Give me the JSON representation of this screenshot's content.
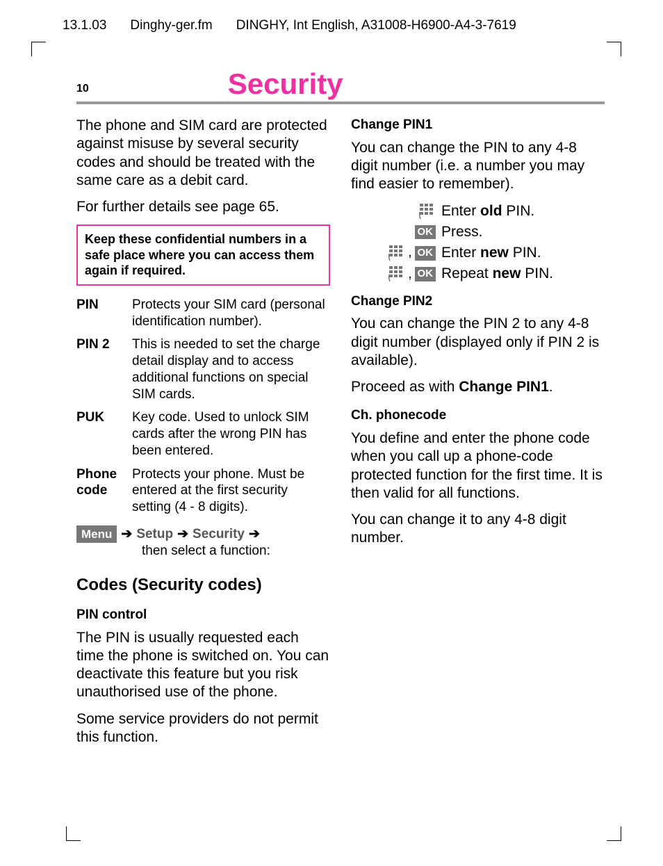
{
  "sheet_header": {
    "date": "13.1.03",
    "file": "Dinghy-ger.fm",
    "doc": "DINGHY, Int English, A31008-H6900-A4-3-7619"
  },
  "page_number": "10",
  "title": "Security",
  "left": {
    "intro1": "The phone and SIM card are protected against misuse by several security codes and should be treated with the same care as a debit card.",
    "intro2": "For further details see page 65.",
    "callout": "Keep these confidential numbers in a safe place where you can access them again if required.",
    "table": [
      {
        "k": "PIN",
        "v": "Protects your SIM card (personal identification number)."
      },
      {
        "k": "PIN 2",
        "v": "This is needed to set the charge detail display and to access additional functions on special SIM cards."
      },
      {
        "k": "PUK",
        "v": "Key code. Used to unlock SIM cards after the wrong PIN has been entered."
      },
      {
        "k": "Phone code",
        "v": "Protects your phone. Must be entered at the first security setting (4 - 8 digits)."
      }
    ],
    "menu": {
      "badge": "Menu",
      "s1": "Setup",
      "s2": "Security",
      "tail": "then select a function:"
    },
    "section": "Codes (Security codes)",
    "pin_ctrl_h": "PIN control",
    "pin_ctrl_p1": "The PIN is usually requested each time the phone is switched on. You can deactivate this feature but you risk unauthorised use of the phone.",
    "pin_ctrl_p2": "Some service providers do not permit this function."
  },
  "right": {
    "cp1_h": "Change PIN1",
    "cp1_p": "You can change the PIN to any 4-8 digit number (i.e. a number you may find easier to remember).",
    "steps": [
      {
        "icons": [
          "keypad"
        ],
        "pre": "Enter ",
        "bold": "old",
        "post": " PIN."
      },
      {
        "icons": [
          "ok"
        ],
        "pre": "Press.",
        "bold": "",
        "post": ""
      },
      {
        "icons": [
          "keypad",
          "comma",
          "ok"
        ],
        "pre": "Enter ",
        "bold": "new",
        "post": " PIN."
      },
      {
        "icons": [
          "keypad",
          "comma",
          "ok"
        ],
        "pre": "Repeat ",
        "bold": "new",
        "post": " PIN."
      }
    ],
    "cp2_h": "Change PIN2",
    "cp2_p1": "You can change the PIN 2 to any 4-8 digit number (displayed only if PIN 2 is available).",
    "cp2_p2_a": "Proceed as with ",
    "cp2_p2_b": "Change PIN1",
    "cp2_p2_c": ".",
    "pc_h": "Ch. phonecode",
    "pc_p1": "You define and enter the phone code when you call up a phone-code protected function for the first time. It is then valid for all functions.",
    "pc_p2": "You can change it to any 4-8 digit number.",
    "ok_label": "OK"
  }
}
